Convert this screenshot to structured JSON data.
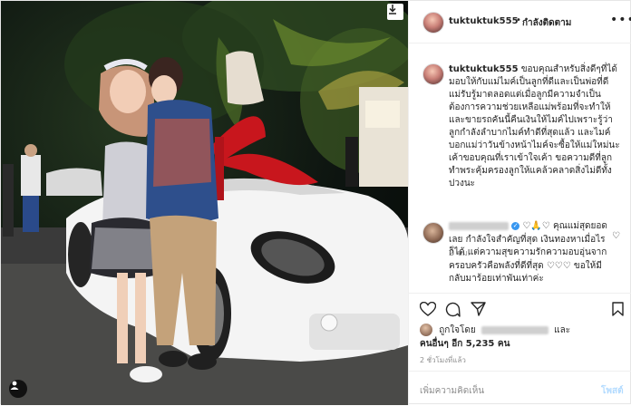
{
  "header": {
    "username": "tuktuktuk555",
    "separator": "•",
    "follow_status": "กำลังติดตาม",
    "more_icon": "more-horizontal-icon"
  },
  "caption": {
    "username": "tuktuktuk555",
    "text": "ขอบคุณสำหรับสิ่งดีๆที่ได้มอบให้กับแม่ไมค์เป็นลูกที่ดีและเป็นพ่อที่ดี แม่รับรู้มาตลอดแต่เมื่อลูกมีความจำเป็นต้องการความช่วยเหลือแม่พร้อมที่จะทำให้ และขายรถคันนี้คืนเงินให้ไมค์ไปเพราะรู้ว่าลูกกำลังลำบากไมค์ทำดีที่สุดแล้ว และไมค์บอกแม่ว่าวันข้างหน้าไมค์จะซื้อให้แม่ใหม่นะ เค้าขอบคุณที่เราเข้าใจเค้า ขอความดีที่ลูกทำพระคุ้มครองลูกให้แคล้วคลาดสิ่งไม่ดีทั้งปวงนะ",
    "time": "2 ชม."
  },
  "comment": {
    "text": "คุณแม่สุดยอดเลย กำลังใจสำคัญที่สุด เงินทองหาเมื่อไรก็ได้ แต่ความสุขความรักความอบอุ่นจากครอบครัวคือพลังที่ดีที่สุด ♡♡♡ ขอให้มีกลับมาร้อยเท่าพันเท่าค่ะ",
    "emojis": "♡🙏♡"
  },
  "likes": {
    "prefix": "ถูกใจโดย",
    "and": "และ",
    "others": "คนอื่นๆ อีก 5,235 คน"
  },
  "post_time": "2 ชั่วโมงที่แล้ว",
  "add_comment": {
    "placeholder": "เพิ่มความคิดเห็น",
    "post_label": "โพสต์"
  }
}
